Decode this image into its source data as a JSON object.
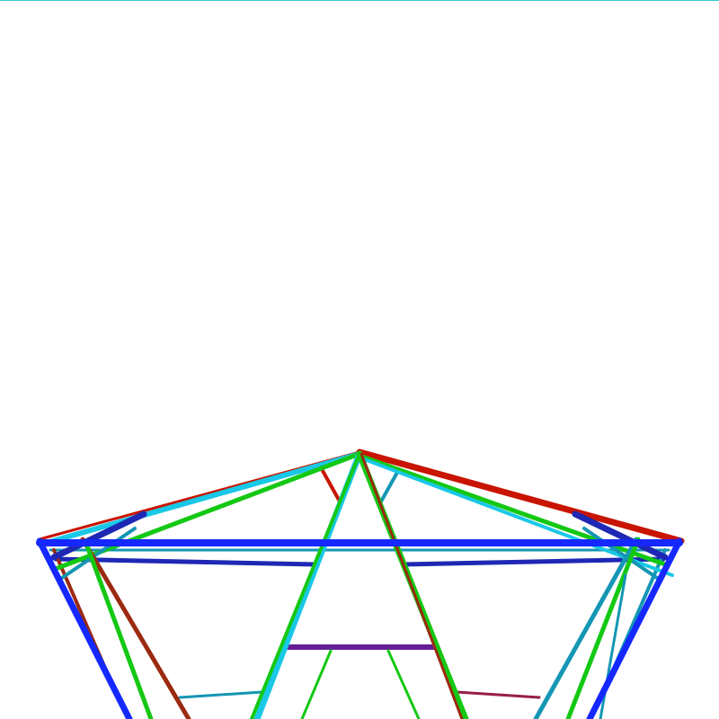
{
  "colors": {
    "background": "#ffffff",
    "top_rule": "#38c8d0",
    "red": "#c81400",
    "dark_red": "#9b2a10",
    "green": "#14c814",
    "cyan": "#19c8e6",
    "blue": "#1428ff",
    "navy": "#1e28b4",
    "teal": "#1496b4",
    "maroon": "#961e46",
    "purple": "#641e96"
  }
}
